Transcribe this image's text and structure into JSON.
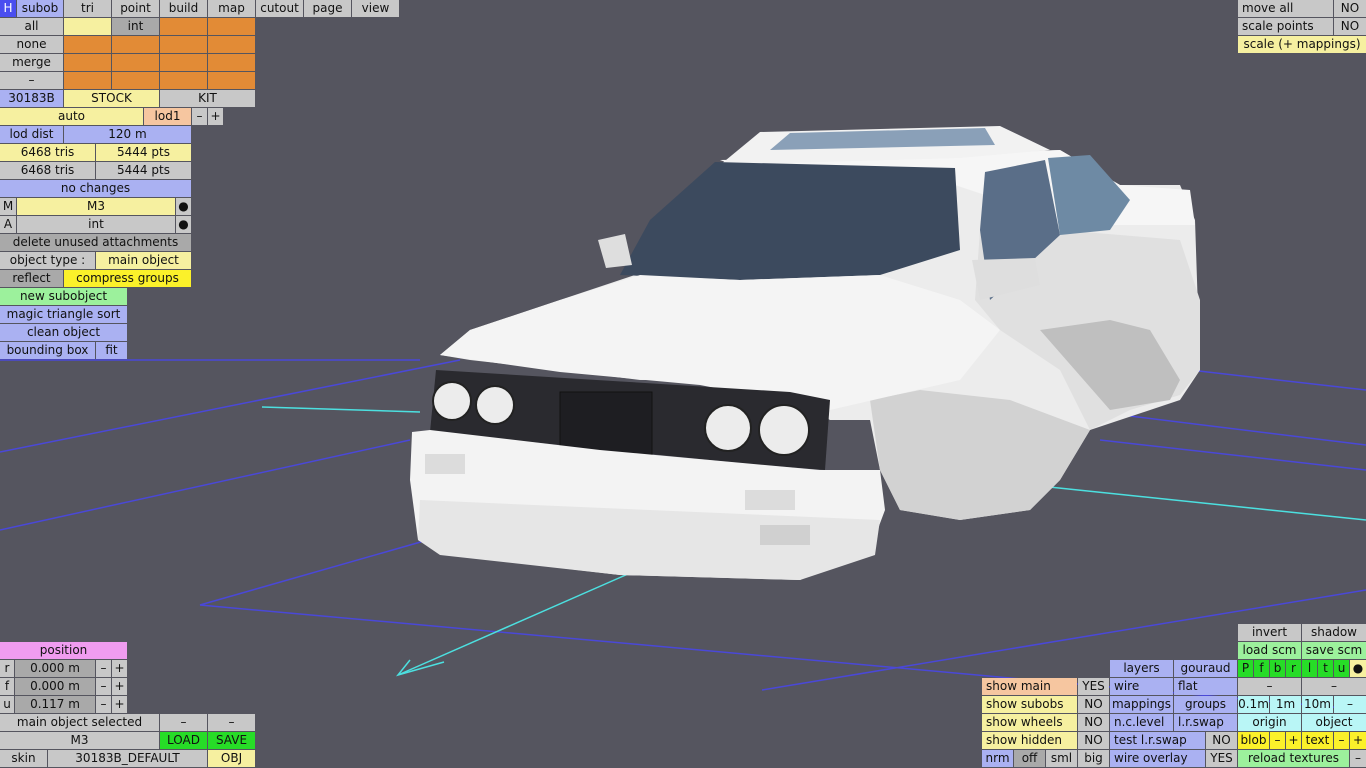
{
  "top_tabs": {
    "h": "H",
    "subob": "subob",
    "tri": "tri",
    "point": "point",
    "build": "build",
    "map": "map",
    "cutout": "cutout",
    "page": "page",
    "view": "view"
  },
  "select_menu": {
    "all": "all",
    "none": "none",
    "merge": "merge",
    "dash": "–",
    "int": "int"
  },
  "subob_panel": {
    "id": "30183B",
    "stock": "STOCK",
    "kit": "KIT",
    "auto": "auto",
    "lod": "lod1",
    "minus": "–",
    "plus": "+",
    "lod_dist_label": "lod dist",
    "lod_dist_value": "120 m",
    "tris1": "6468 tris",
    "pts1": "5444 pts",
    "tris2": "6468 tris",
    "pts2": "5444 pts",
    "status": "no changes",
    "m_key": "M",
    "m_value": "M3",
    "a_key": "A",
    "a_value": "int",
    "dot": "●",
    "delete_unused": "delete unused attachments",
    "object_type_label": "object type :",
    "object_type_value": "main object",
    "reflect": "reflect",
    "compress_groups": "compress groups",
    "new_subobject": "new subobject",
    "magic_sort": "magic triangle sort",
    "clean_object": "clean object",
    "bounding_box": "bounding box",
    "fit": "fit"
  },
  "position_panel": {
    "title": "position",
    "rows": [
      {
        "axis": "r",
        "value": "0.000 m"
      },
      {
        "axis": "f",
        "value": "0.000 m"
      },
      {
        "axis": "u",
        "value": "0.117 m"
      }
    ],
    "minus": "–",
    "plus": "+",
    "main_selected": "main object selected",
    "model": "M3",
    "load": "LOAD",
    "save": "SAVE",
    "skin_label": "skin",
    "skin_value": "30183B_DEFAULT",
    "obj": "OBJ"
  },
  "top_right": {
    "move_all": "move all",
    "move_all_val": "NO",
    "scale_points": "scale points",
    "scale_points_val": "NO",
    "scale_mappings": "scale (+ mappings)"
  },
  "bottom_right": {
    "invert": "invert",
    "shadow": "shadow",
    "load_scm": "load scm",
    "save_scm": "save scm",
    "letters": [
      "P",
      "f",
      "b",
      "r",
      "l",
      "t",
      "u"
    ],
    "dot": "●",
    "layers": "layers",
    "gouraud": "gouraud",
    "wire": "wire",
    "flat": "flat",
    "dash": "–",
    "mappings": "mappings",
    "groups": "groups",
    "d01": "0.1m",
    "d1": "1m",
    "d10": "10m",
    "nclevel": "n.c.level",
    "lrswap": "l.r.swap",
    "origin": "origin",
    "object": "object",
    "test_lrswap": "test l.r.swap",
    "test_lrswap_val": "NO",
    "blob": "blob",
    "text": "text",
    "minus": "–",
    "plus": "+",
    "wire_overlay": "wire overlay",
    "wire_overlay_val": "YES",
    "reload_textures": "reload textures",
    "show_main": "show main",
    "show_main_val": "YES",
    "show_subobs": "show subobs",
    "show_subobs_val": "NO",
    "show_wheels": "show wheels",
    "show_wheels_val": "NO",
    "show_hidden": "show hidden",
    "show_hidden_val": "NO",
    "nrm": "nrm",
    "off": "off",
    "sml": "sml",
    "big": "big"
  }
}
